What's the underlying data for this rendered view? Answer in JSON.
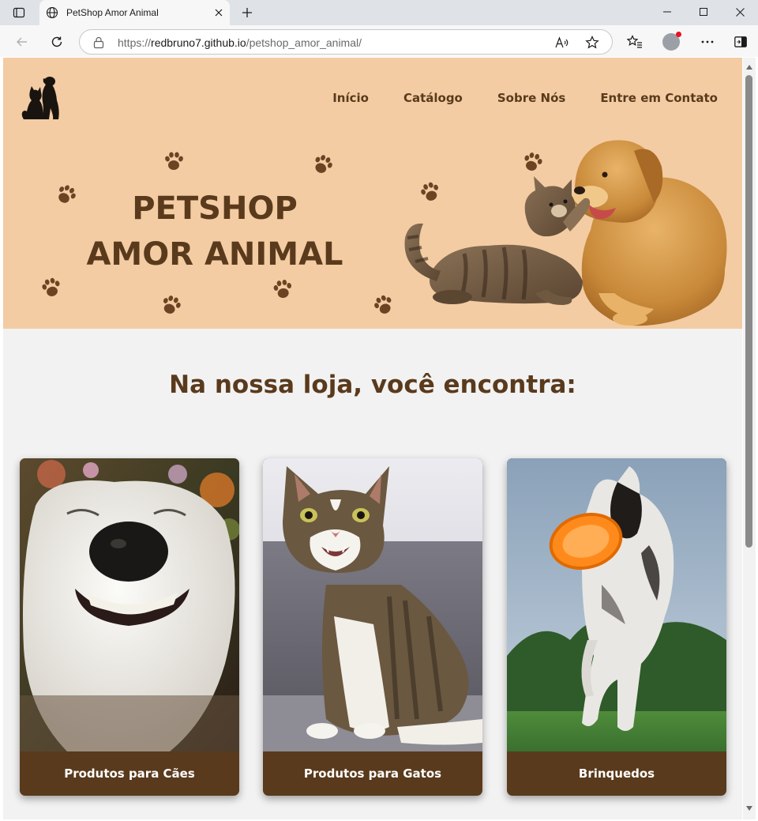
{
  "browser": {
    "tab_title": "PetShop Amor Animal",
    "url_protocol": "https://",
    "url_host": "redbruno7.github.io",
    "url_path": "/petshop_amor_animal/"
  },
  "site": {
    "nav": [
      "Início",
      "Catálogo",
      "Sobre Nós",
      "Entre em Contato"
    ],
    "hero_title_line1": "PETSHOP",
    "hero_title_line2": "AMOR ANIMAL",
    "section_title": "Na nossa loja, você encontra:",
    "cards": [
      {
        "label": "Produtos para Cães"
      },
      {
        "label": "Produtos para Gatos"
      },
      {
        "label": "Brinquedos"
      }
    ]
  },
  "colors": {
    "hero_bg": "#f3cca3",
    "brand_brown": "#5a3a1c",
    "page_bg": "#f2f2f2",
    "card_label_text": "#ffffff"
  },
  "icons": [
    "tab-actions-icon",
    "globe-icon",
    "close-icon",
    "plus-icon",
    "minimize-icon",
    "maximize-icon",
    "close-window-icon",
    "back-icon",
    "refresh-icon",
    "lock-icon",
    "read-aloud-icon",
    "favorite-star-icon",
    "favorites-icon",
    "profile-icon",
    "more-icon",
    "sidebar-icon",
    "paw-icon",
    "pet-logo-icon"
  ]
}
